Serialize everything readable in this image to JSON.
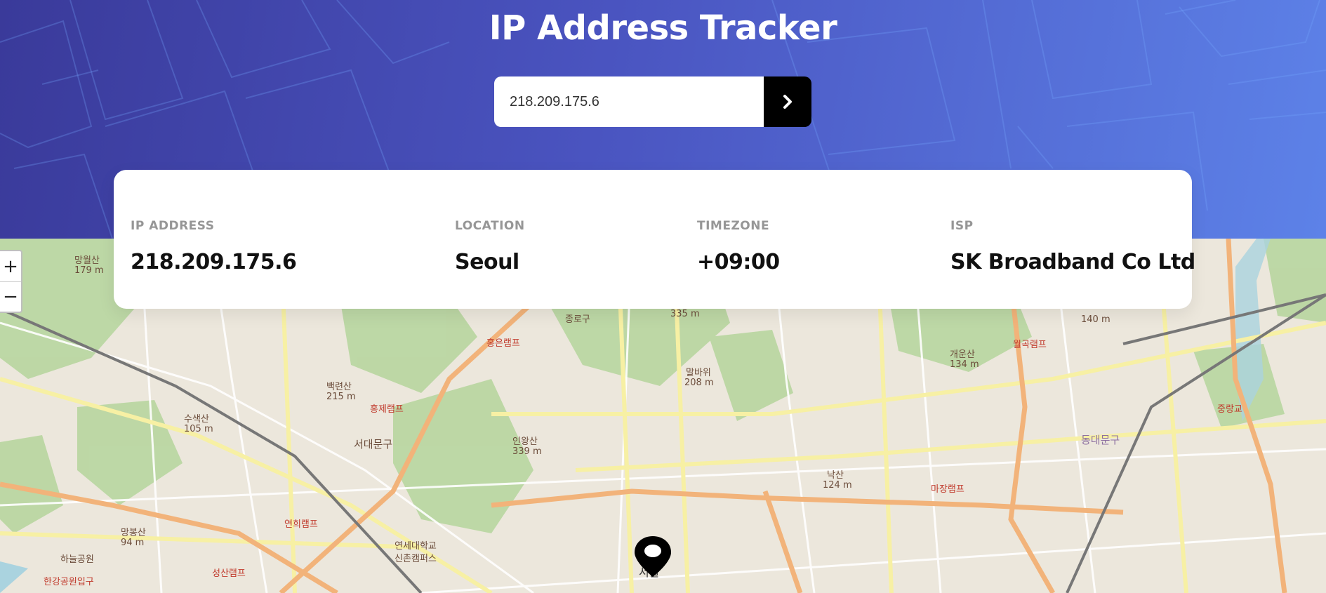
{
  "app": {
    "title": "IP Address Tracker"
  },
  "search": {
    "value": "218.209.175.6",
    "submit_icon": "chevron-right-icon"
  },
  "info": [
    {
      "label": "IP ADDRESS",
      "value": "218.209.175.6"
    },
    {
      "label": "LOCATION",
      "value": "Seoul"
    },
    {
      "label": "TIMEZONE",
      "value": "+09:00"
    },
    {
      "label": "ISP",
      "value": "SK Broadband Co Ltd"
    }
  ],
  "map": {
    "zoom_in_label": "+",
    "zoom_out_label": "−",
    "marker_icon": "location-pin-icon",
    "place_labels": [
      "망월산",
      "179 m",
      "종로구",
      "335 m",
      "홍은램프",
      "말바위",
      "208 m",
      "백련산",
      "215 m",
      "홍제램프",
      "수색산",
      "105 m",
      "서대문구",
      "인왕산",
      "339 m",
      "낙산",
      "124 m",
      "개운산",
      "134 m",
      "월곡램프",
      "140 m",
      "동대문구",
      "중랑교",
      "마장램프",
      "연희램프",
      "망봉산",
      "94 m",
      "하늘공원",
      "연세대학교신촌캠퍼스",
      "한강공원입구",
      "성산램프",
      "서울"
    ]
  },
  "colors": {
    "header_start": "#3a3a9a",
    "header_end": "#5d82e8",
    "button": "#000000",
    "label_gray": "#969696"
  }
}
